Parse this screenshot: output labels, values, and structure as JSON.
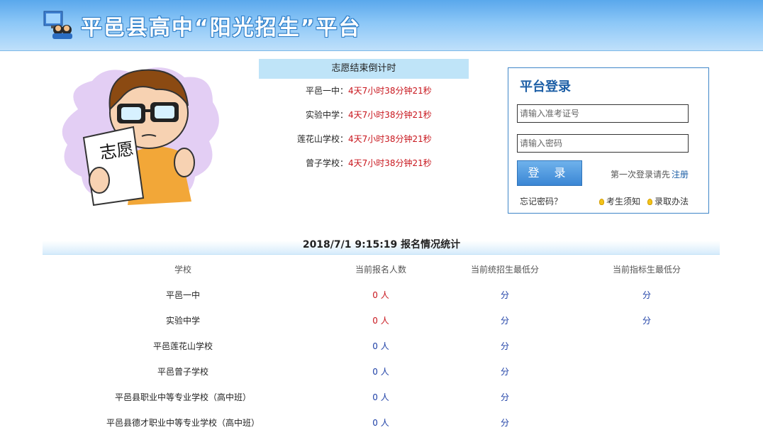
{
  "header": {
    "title": "平邑县高中“阳光招生”平台"
  },
  "countdown": {
    "title": "志愿结束倒计时",
    "rows": [
      {
        "school": "平邑一中：",
        "time": "4天7小时38分钟21秒"
      },
      {
        "school": "实验中学：",
        "time": "4天7小时38分钟21秒"
      },
      {
        "school": "莲花山学校：",
        "time": "4天7小时38分钟21秒"
      },
      {
        "school": "曾子学校：",
        "time": "4天7小时38分钟21秒"
      }
    ]
  },
  "illustration": {
    "text": "志愿"
  },
  "login": {
    "title": "平台登录",
    "username_placeholder": "请输入准考证号",
    "password_placeholder": "请输入密码",
    "login_button": "登 录",
    "first_login_text": "第一次登录请先",
    "register_link": "注册",
    "forgot_password": "忘记密码？",
    "notice_link": "考生须知",
    "admission_link": "录取办法"
  },
  "stats": {
    "title": "2018/7/1 9:15:19 报名情况统计",
    "headers": [
      "学校",
      "当前报名人数",
      "当前统招生最低分",
      "当前指标生最低分"
    ],
    "rows": [
      {
        "school": "平邑一中",
        "count": "0 人",
        "count_color": "red",
        "unified_min": "分",
        "quota_min": "分"
      },
      {
        "school": "实验中学",
        "count": "0 人",
        "count_color": "red",
        "unified_min": "分",
        "quota_min": "分"
      },
      {
        "school": "平邑莲花山学校",
        "count": "0 人",
        "count_color": "blue",
        "unified_min": "分",
        "quota_min": ""
      },
      {
        "school": "平邑曾子学校",
        "count": "0 人",
        "count_color": "blue",
        "unified_min": "分",
        "quota_min": ""
      },
      {
        "school": "平邑县职业中等专业学校（高中班）",
        "count": "0 人",
        "count_color": "blue",
        "unified_min": "分",
        "quota_min": ""
      },
      {
        "school": "平邑县德才职业中等专业学校（高中班）",
        "count": "0 人",
        "count_color": "blue",
        "unified_min": "分",
        "quota_min": ""
      }
    ]
  },
  "colors": {
    "header_blue": "#5aa8ec",
    "countdown_red": "#c8161d",
    "link_blue": "#1d5fa6",
    "login_border": "#3f86c8"
  }
}
